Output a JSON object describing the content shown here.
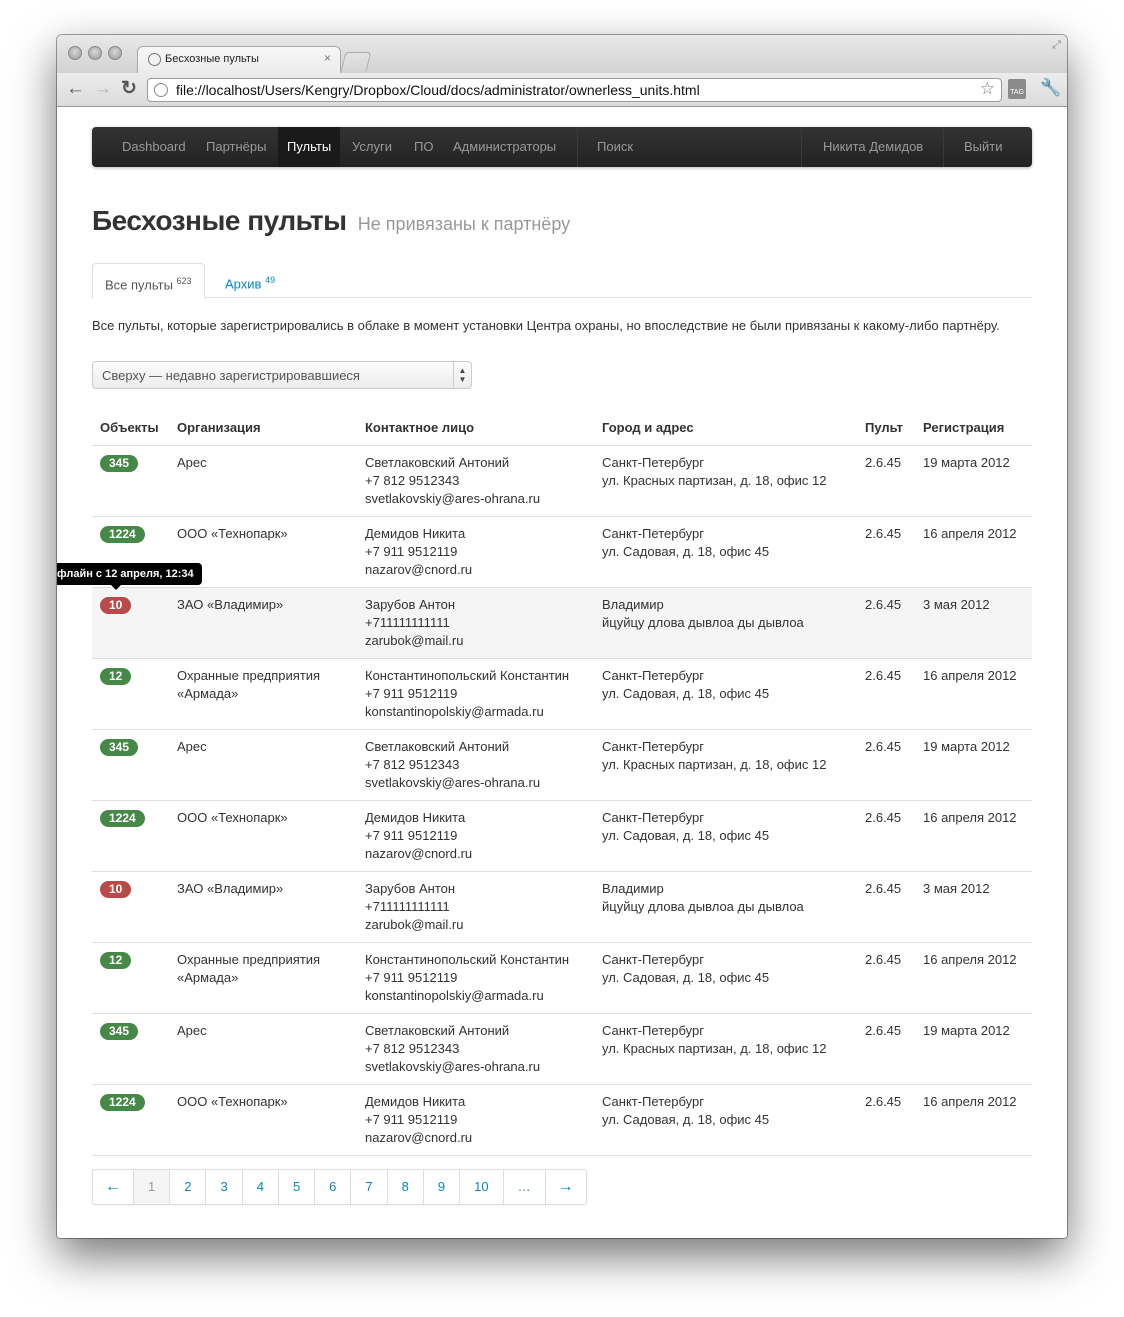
{
  "browser": {
    "tab_title": "Бесхозные пульты",
    "tab_close": "×",
    "url": "file://localhost/Users/Kengry/Dropbox/Cloud/docs/administrator/ownerless_units.html",
    "tag_label": "TAG"
  },
  "nav": {
    "items": [
      "Dashboard",
      "Партнёры",
      "Пульты",
      "Услуги",
      "ПО",
      "Администраторы"
    ],
    "active": "Пульты",
    "search": "Поиск",
    "user": "Никита Демидов",
    "logout": "Выйти"
  },
  "page": {
    "title": "Бесхозные пульты",
    "subtitle": "Не привязаны к партнёру",
    "description": "Все пульты, которые зарегистрировались в облаке в момент установки Центра охраны, но впоследствие не были привязаны к какому-либо партнёру."
  },
  "tabs": [
    {
      "label": "Все пульты",
      "count": "623"
    },
    {
      "label": "Архив",
      "count": "49"
    }
  ],
  "sort": {
    "selected": "Сверху — недавно зарегистрировавшиеся"
  },
  "table": {
    "headers": [
      "Объекты",
      "Организация",
      "Контактное лицо",
      "Город и адрес",
      "Пульт",
      "Регистрация"
    ],
    "rows": [
      {
        "objects": "345",
        "status": "ok",
        "org": "Арес",
        "contact": "Светлаковский Антоний",
        "phone": "+7 812 9512343",
        "email": "svetlakovskiy@ares-ohrana.ru",
        "city": "Санкт-Петербург",
        "address": "ул. Красных партизан, д. 18, офис 12",
        "version": "2.6.45",
        "date": "19 марта 2012"
      },
      {
        "objects": "1224",
        "status": "ok",
        "org": "ООО «Технопарк»",
        "contact": "Демидов Никита",
        "phone": "+7 911 9512119",
        "email": "nazarov@cnord.ru",
        "city": "Санкт-Петербург",
        "address": "ул. Садовая, д. 18, офис 45",
        "version": "2.6.45",
        "date": "16 апреля 2012"
      },
      {
        "objects": "10",
        "status": "err",
        "org": "ЗАО «Владимир»",
        "contact": "Зарубов Антон",
        "phone": "+711111111111",
        "email": "zarubok@mail.ru",
        "city": "Владимир",
        "address": "йцуйцу длова дывлоа ды дывлоа",
        "version": "2.6.45",
        "date": "3 мая 2012"
      },
      {
        "objects": "12",
        "status": "ok",
        "org": "Охранные предприятия «Армада»",
        "contact": "Константинопольский Константин",
        "phone": "+7 911 9512119",
        "email": "konstantinopolskiy@armada.ru",
        "city": "Санкт-Петербург",
        "address": "ул. Садовая, д. 18, офис 45",
        "version": "2.6.45",
        "date": "16 апреля 2012"
      },
      {
        "objects": "345",
        "status": "ok",
        "org": "Арес",
        "contact": "Светлаковский Антоний",
        "phone": "+7 812 9512343",
        "email": "svetlakovskiy@ares-ohrana.ru",
        "city": "Санкт-Петербург",
        "address": "ул. Красных партизан, д. 18, офис 12",
        "version": "2.6.45",
        "date": "19 марта 2012"
      },
      {
        "objects": "1224",
        "status": "ok",
        "org": "ООО «Технопарк»",
        "contact": "Демидов Никита",
        "phone": "+7 911 9512119",
        "email": "nazarov@cnord.ru",
        "city": "Санкт-Петербург",
        "address": "ул. Садовая, д. 18, офис 45",
        "version": "2.6.45",
        "date": "16 апреля 2012"
      },
      {
        "objects": "10",
        "status": "err",
        "org": "ЗАО «Владимир»",
        "contact": "Зарубов Антон",
        "phone": "+711111111111",
        "email": "zarubok@mail.ru",
        "city": "Владимир",
        "address": "йцуйцу длова дывлоа ды дывлоа",
        "version": "2.6.45",
        "date": "3 мая 2012"
      },
      {
        "objects": "12",
        "status": "ok",
        "org": "Охранные предприятия «Армада»",
        "contact": "Константинопольский Константин",
        "phone": "+7 911 9512119",
        "email": "konstantinopolskiy@armada.ru",
        "city": "Санкт-Петербург",
        "address": "ул. Садовая, д. 18, офис 45",
        "version": "2.6.45",
        "date": "16 апреля 2012"
      },
      {
        "objects": "345",
        "status": "ok",
        "org": "Арес",
        "contact": "Светлаковский Антоний",
        "phone": "+7 812 9512343",
        "email": "svetlakovskiy@ares-ohrana.ru",
        "city": "Санкт-Петербург",
        "address": "ул. Красных партизан, д. 18, офис 12",
        "version": "2.6.45",
        "date": "19 марта 2012"
      },
      {
        "objects": "1224",
        "status": "ok",
        "org": "ООО «Технопарк»",
        "contact": "Демидов Никита",
        "phone": "+7 911 9512119",
        "email": "nazarov@cnord.ru",
        "city": "Санкт-Петербург",
        "address": "ул. Садовая, д. 18, офис 45",
        "version": "2.6.45",
        "date": "16 апреля 2012"
      }
    ]
  },
  "tooltip": "флайн с 12 апреля, 12:34",
  "pagination": {
    "prev": "←",
    "pages": [
      "1",
      "2",
      "3",
      "4",
      "5",
      "6",
      "7",
      "8",
      "9",
      "10",
      "…"
    ],
    "current": "1",
    "next": "→"
  },
  "colors": {
    "badge_ok": "#468847",
    "badge_err": "#b94a48",
    "link": "#0088cc",
    "navbar": "#222222"
  }
}
